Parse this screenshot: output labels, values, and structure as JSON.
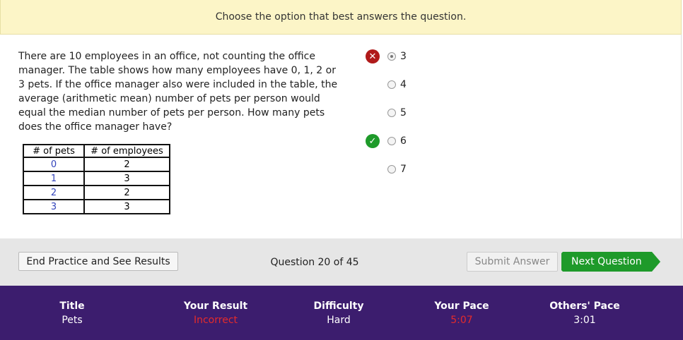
{
  "banner": {
    "text": "Choose the option that best answers the question."
  },
  "question": {
    "text": "There are 10 employees in an office, not counting the office manager. The table shows how many employees have 0, 1, 2 or 3 pets. If the office manager also were included in the table, the average (arithmetic mean) number of pets per person would equal the median number of pets per person. How many pets does the office manager have?",
    "table": {
      "headers": [
        "# of pets",
        "# of employees"
      ],
      "rows": [
        [
          "0",
          "2"
        ],
        [
          "1",
          "3"
        ],
        [
          "2",
          "2"
        ],
        [
          "3",
          "3"
        ]
      ]
    }
  },
  "options": [
    {
      "label": "3",
      "selected": true,
      "mark": "incorrect"
    },
    {
      "label": "4",
      "selected": false,
      "mark": ""
    },
    {
      "label": "5",
      "selected": false,
      "mark": ""
    },
    {
      "label": "6",
      "selected": false,
      "mark": "correct"
    },
    {
      "label": "7",
      "selected": false,
      "mark": ""
    }
  ],
  "toolbar": {
    "end_label": "End Practice and See Results",
    "question_counter": "Question 20 of 45",
    "submit_label": "Submit Answer",
    "next_label": "Next Question"
  },
  "footer": {
    "title": {
      "label": "Title",
      "value": "Pets"
    },
    "result": {
      "label": "Your Result",
      "value": "Incorrect"
    },
    "difficulty": {
      "label": "Difficulty",
      "value": "Hard"
    },
    "pace": {
      "label": "Your Pace",
      "value": "5:07"
    },
    "others_pace": {
      "label": "Others' Pace",
      "value": "3:01"
    }
  },
  "colors": {
    "banner_bg": "#fcf5c7",
    "incorrect_mark": "#b01a1a",
    "correct_mark": "#1e9a2a",
    "next_button": "#1e9a2a",
    "footer_bg": "#3c1d6e",
    "alert_text": "#e52b2b"
  }
}
